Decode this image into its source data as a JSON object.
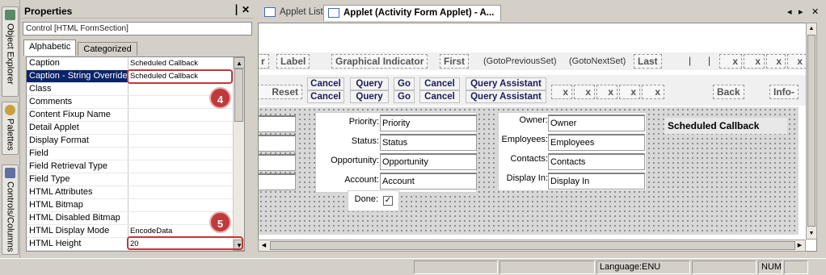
{
  "side_tabs": [
    "Object Explorer",
    "Palettes",
    "Controls/Columns"
  ],
  "properties": {
    "title": "Properties",
    "pin_glyph": "▕",
    "close_glyph": "✕",
    "control_label": "Control [HTML FormSection]",
    "tabs": [
      "Alphabetic",
      "Categorized"
    ],
    "rows": [
      {
        "name": "Caption",
        "value": "Scheduled Callback"
      },
      {
        "name": "Caption - String Override",
        "value": "Scheduled Callback"
      },
      {
        "name": "Class",
        "value": ""
      },
      {
        "name": "Comments",
        "value": ""
      },
      {
        "name": "Content Fixup Name",
        "value": ""
      },
      {
        "name": "Detail Applet",
        "value": ""
      },
      {
        "name": "Display Format",
        "value": ""
      },
      {
        "name": "Field",
        "value": ""
      },
      {
        "name": "Field Retrieval Type",
        "value": ""
      },
      {
        "name": "Field Type",
        "value": ""
      },
      {
        "name": "HTML Attributes",
        "value": ""
      },
      {
        "name": "HTML Bitmap",
        "value": ""
      },
      {
        "name": "HTML Disabled Bitmap",
        "value": ""
      },
      {
        "name": "HTML Display Mode",
        "value": "EncodeData"
      },
      {
        "name": "HTML Height",
        "value": "20"
      }
    ],
    "badges": [
      "4",
      "5"
    ]
  },
  "doc_tabs": [
    "Applet List",
    "Applet (Activity Form Applet) - A..."
  ],
  "nav": {
    "left": "◂",
    "right": "▸",
    "close": "✕"
  },
  "layout_controls": {
    "row1": [
      "r",
      "Label",
      "Graphical Indicator",
      "First",
      "(GotoPreviousSet)",
      "(GotoNextSet)",
      "Last",
      "x",
      "x",
      "x",
      "x"
    ],
    "row2": [
      "Reset",
      "Cancel",
      "Query",
      "Go",
      "Cancel",
      "Query Assistant",
      "Cancel",
      "Query",
      "Go",
      "Cancel",
      "Query Assistant",
      "x",
      "x",
      "x",
      "x",
      "x",
      "Back",
      "Info-"
    ]
  },
  "form": {
    "fields_a": [
      {
        "label": "Priority:",
        "value": "Priority"
      },
      {
        "label": "Status:",
        "value": "Status"
      },
      {
        "label": "Opportunity:",
        "value": "Opportunity"
      },
      {
        "label": "Account:",
        "value": "Account"
      }
    ],
    "done_label": "Done:",
    "done_check": "✓",
    "fields_b": [
      {
        "label": "Owner:",
        "value": "Owner"
      },
      {
        "label": "Employees:",
        "value": "Employees"
      },
      {
        "label": "Contacts:",
        "value": "Contacts"
      },
      {
        "label": "Display In:",
        "value": "Display In"
      }
    ],
    "section_caption": "Scheduled Callback"
  },
  "statusbar": {
    "language": "Language:ENU",
    "num": "NUM"
  }
}
